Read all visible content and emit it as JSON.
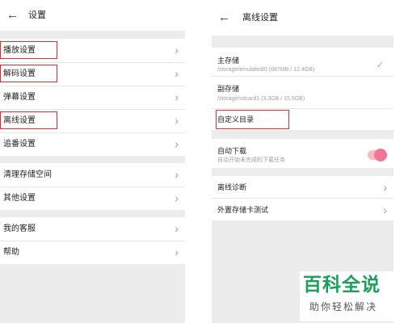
{
  "left": {
    "title": "设置",
    "back_icon": "arrow-left-icon",
    "groups": [
      [
        "播放设置",
        "解码设置",
        "弹幕设置",
        "离线设置",
        "追番设置"
      ],
      [
        "清理存储空间",
        "其他设置"
      ],
      [
        "我的客服",
        "帮助"
      ]
    ],
    "highlighted": [
      "播放设置",
      "解码设置",
      "离线设置"
    ]
  },
  "right": {
    "title": "离线设置",
    "back_icon": "arrow-left-icon",
    "storage": [
      {
        "title": "主存储",
        "path": "/storage/emulated/0 (687MB / 12.4GB)",
        "selected": true
      },
      {
        "title": "副存储",
        "path": "/storage/sdcard1 (3.3GB / 15.5GB)",
        "selected": false
      }
    ],
    "custom_dir": "自定义目录",
    "auto_download": {
      "title": "自动下载",
      "subtitle": "自动开始未完成的下载任务",
      "enabled": true
    },
    "items": [
      "离线诊断",
      "外置存储卡测试"
    ]
  },
  "watermark": {
    "title": "百科全说",
    "subtitle": "助你轻松解决"
  },
  "colors": {
    "highlight_box": "#d9302f",
    "toggle_on": "#f07696",
    "check": "#f08aa0",
    "watermark_green": "#1aa05a"
  }
}
